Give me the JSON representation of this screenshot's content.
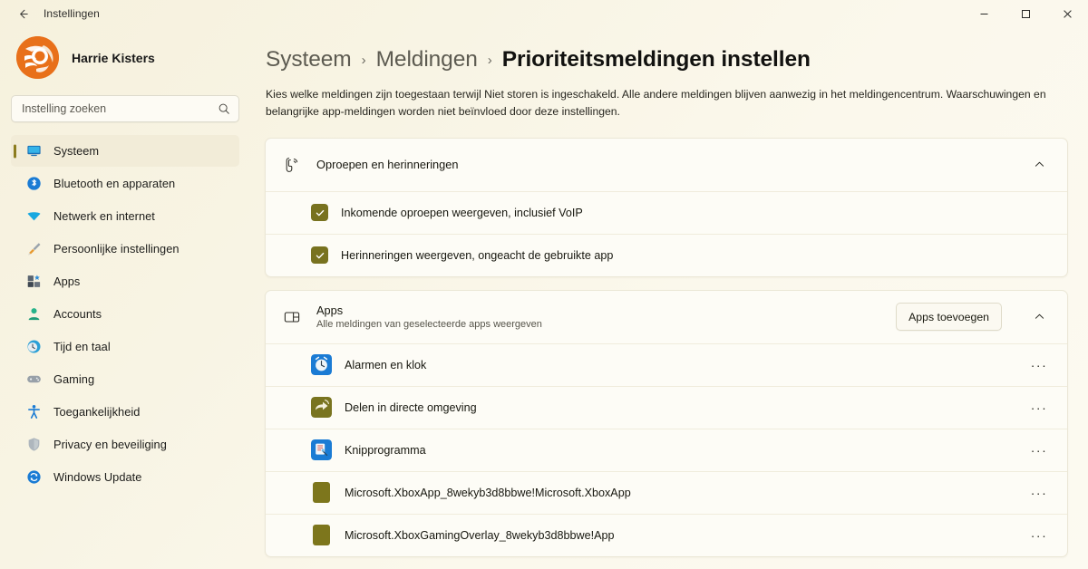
{
  "window": {
    "title": "Instellingen",
    "back_icon": "arrow-left-icon",
    "minimize_label": "─",
    "maximize_label": "□",
    "close_label": "✕"
  },
  "sidebar": {
    "profile": {
      "name": "Harrie Kisters",
      "avatar_icon": "user-avatar-logo",
      "avatar_color": "#e8701a"
    },
    "search": {
      "placeholder": "Instelling zoeken",
      "value": "",
      "icon": "search-icon"
    },
    "accent_color": "#8c7c1e",
    "items": [
      {
        "label": "Systeem",
        "icon": "monitor-icon",
        "selected": true
      },
      {
        "label": "Bluetooth en apparaten",
        "icon": "bluetooth-icon",
        "selected": false
      },
      {
        "label": "Netwerk en internet",
        "icon": "wifi-icon",
        "selected": false
      },
      {
        "label": "Persoonlijke instellingen",
        "icon": "paintbrush-icon",
        "selected": false
      },
      {
        "label": "Apps",
        "icon": "apps-grid-icon",
        "selected": false
      },
      {
        "label": "Accounts",
        "icon": "person-icon",
        "selected": false
      },
      {
        "label": "Tijd en taal",
        "icon": "clock-globe-icon",
        "selected": false
      },
      {
        "label": "Gaming",
        "icon": "gamepad-icon",
        "selected": false
      },
      {
        "label": "Toegankelijkheid",
        "icon": "accessibility-icon",
        "selected": false
      },
      {
        "label": "Privacy en beveiliging",
        "icon": "shield-icon",
        "selected": false
      },
      {
        "label": "Windows Update",
        "icon": "update-arrows-icon",
        "selected": false
      }
    ]
  },
  "main": {
    "breadcrumb": [
      {
        "label": "Systeem",
        "current": false
      },
      {
        "label": "Meldingen",
        "current": false
      },
      {
        "label": "Prioriteitsmeldingen instellen",
        "current": true
      }
    ],
    "breadcrumb_separator": "›",
    "description": "Kies welke meldingen zijn toegestaan terwijl Niet storen is ingeschakeld. Alle andere meldingen blijven aanwezig in het meldingencentrum. Waarschuwingen en belangrijke app-meldingen worden niet beïnvloed door deze instellingen.",
    "calls_section": {
      "icon": "phone-call-icon",
      "title": "Oproepen en herinneringen",
      "collapse_icon": "chevron-up-icon",
      "checkbox_color": "#78721f",
      "options": [
        {
          "label": "Inkomende oproepen weergeven, inclusief VoIP",
          "checked": true
        },
        {
          "label": "Herinneringen weergeven, ongeacht de gebruikte app",
          "checked": true
        }
      ]
    },
    "apps_section": {
      "icon": "app-window-icon",
      "title": "Apps",
      "subtitle": "Alle meldingen van geselecteerde apps weergeven",
      "add_button_label": "Apps toevoegen",
      "collapse_icon": "chevron-up-icon",
      "more_label": "···",
      "apps": [
        {
          "name": "Alarmen en klok",
          "icon": "alarm-clock-icon",
          "icon_color": "#1a7bd4"
        },
        {
          "name": "Delen in directe omgeving",
          "icon": "nearby-share-icon",
          "icon_color": "#79741f"
        },
        {
          "name": "Knipprogramma",
          "icon": "snipping-tool-icon",
          "icon_color": "#1a7bd4"
        },
        {
          "name": "Microsoft.XboxApp_8wekyb3d8bbwe!Microsoft.XboxApp",
          "icon": "generic-app-icon",
          "icon_color": "#7d761c"
        },
        {
          "name": "Microsoft.XboxGamingOverlay_8wekyb3d8bbwe!App",
          "icon": "generic-app-icon",
          "icon_color": "#7d761c"
        }
      ]
    }
  }
}
